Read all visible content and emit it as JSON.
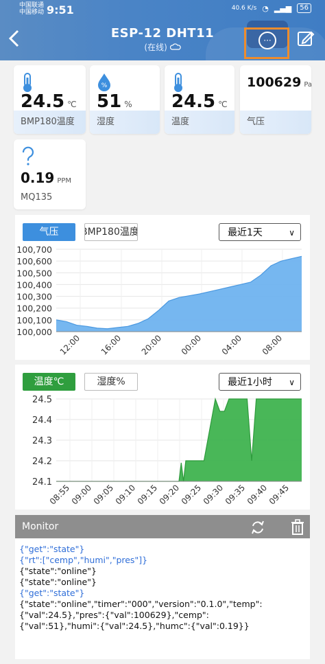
{
  "status_bar": {
    "carrier1": "中国联通",
    "carrier2": "中国移动",
    "time": "9:51",
    "speed": "40.6 K/s",
    "battery": "56"
  },
  "header": {
    "title": "ESP-12 DHT11",
    "subtitle": "(在线)"
  },
  "cards": [
    {
      "value": "24.5",
      "unit": "℃",
      "label": "BMP180温度",
      "icon": "thermometer-icon"
    },
    {
      "value": "51",
      "unit": "%",
      "label": "湿度",
      "icon": "humidity-drop-icon"
    },
    {
      "value": "24.5",
      "unit": "℃",
      "label": "温度",
      "icon": "thermometer-icon"
    },
    {
      "value": "100629",
      "unit": "Pa",
      "label": "气压",
      "icon": ""
    },
    {
      "value": "0.19",
      "unit": "PPM",
      "label": "MQ135",
      "icon": "question-icon"
    }
  ],
  "chart1": {
    "tabs": [
      "气压",
      "BMP180温度"
    ],
    "range": "最近1天",
    "chart_data": {
      "type": "area",
      "x_ticks": [
        "12:00",
        "16:00",
        "20:00",
        "00:00",
        "04:00",
        "08:00"
      ],
      "y_ticks": [
        "100,000",
        "100,100",
        "100,200",
        "100,300",
        "100,400",
        "100,500",
        "100,600",
        "100,700"
      ],
      "ylim": [
        100000,
        100700
      ],
      "xlim": [
        9.5,
        33.5
      ],
      "series": [
        {
          "color": "#6fb3ef",
          "points": [
            [
              9.5,
              100100
            ],
            [
              10.5,
              100085
            ],
            [
              11.5,
              100055
            ],
            [
              12.5,
              100045
            ],
            [
              13.5,
              100030
            ],
            [
              14.5,
              100025
            ],
            [
              15.5,
              100035
            ],
            [
              16.5,
              100045
            ],
            [
              17.5,
              100070
            ],
            [
              18.5,
              100110
            ],
            [
              19.5,
              100180
            ],
            [
              20.5,
              100260
            ],
            [
              21.5,
              100290
            ],
            [
              22.5,
              100305
            ],
            [
              23.5,
              100320
            ],
            [
              24.5,
              100340
            ],
            [
              25.5,
              100360
            ],
            [
              26.5,
              100380
            ],
            [
              27.5,
              100400
            ],
            [
              28.5,
              100420
            ],
            [
              29.5,
              100480
            ],
            [
              30.5,
              100560
            ],
            [
              31.5,
              100600
            ],
            [
              32.5,
              100620
            ],
            [
              33.5,
              100640
            ]
          ]
        }
      ]
    }
  },
  "chart2": {
    "tabs": [
      "温度℃",
      "湿度%"
    ],
    "range": "最近1小时",
    "chart_data": {
      "type": "area",
      "x_ticks": [
        "08:55",
        "09:00",
        "09:05",
        "09:10",
        "09:15",
        "09:20",
        "09:25",
        "09:30",
        "09:35",
        "09:40",
        "09:45"
      ],
      "y_ticks": [
        "24.1",
        "24.2",
        "24.3",
        "24.4",
        "24.5"
      ],
      "ylim": [
        24.1,
        24.5
      ],
      "xlim": [
        535,
        589
      ],
      "series": [
        {
          "color": "#3fb34f",
          "points": [
            [
              535,
              24.1
            ],
            [
              562,
              24.1
            ],
            [
              562.5,
              24.19
            ],
            [
              563,
              24.1
            ],
            [
              563.5,
              24.2
            ],
            [
              567.5,
              24.2
            ],
            [
              570,
              24.5
            ],
            [
              571,
              24.44
            ],
            [
              572,
              24.44
            ],
            [
              573,
              24.5
            ],
            [
              577,
              24.5
            ],
            [
              578,
              24.2
            ],
            [
              579,
              24.5
            ],
            [
              589,
              24.5
            ]
          ]
        }
      ]
    }
  },
  "monitor": {
    "title": "Monitor",
    "lines": [
      {
        "text": "{\"get\":\"state\"}",
        "color": "blue"
      },
      {
        "text": "{\"rt\":[\"cemp\",\"humi\",\"pres\"]}",
        "color": "blue"
      },
      {
        "text": "{\"state\":\"online\"}",
        "color": "black"
      },
      {
        "text": "{\"state\":\"online\"}",
        "color": "black"
      },
      {
        "text": "{\"get\":\"state\"}",
        "color": "blue"
      },
      {
        "text": "{\"state\":\"online\",\"timer\":\"000\",\"version\":\"0.1.0\",\"temp\":{\"val\":24.5},\"pres\":{\"val\":100629},\"cemp\":{\"val\":51},\"humi\":{\"val\":24.5},\"humc\":{\"val\":0.19}}",
        "color": "black"
      }
    ]
  }
}
